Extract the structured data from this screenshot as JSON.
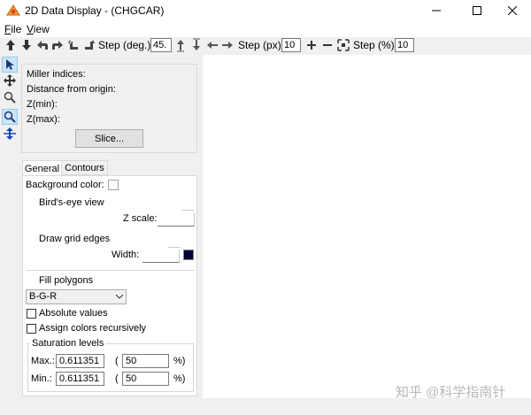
{
  "window": {
    "title": "2D Data Display - (CHGCAR)",
    "minimize_icon": "minimize-icon",
    "maximize_icon": "maximize-icon",
    "close_icon": "close-icon"
  },
  "menu": {
    "items": [
      "File",
      "View"
    ]
  },
  "toolbar": {
    "step_deg_label": "Step (deg.):",
    "step_deg_value": "45.",
    "step_px_label": "Step (px):",
    "step_px_value": "10",
    "step_pct_label": "Step (%):",
    "step_pct_value": "10"
  },
  "panel": {
    "miller_label": "Miller indices:",
    "distance_label": "Distance from origin:",
    "zmin_label": "Z(min):",
    "zmax_label": "Z(max):",
    "slice_button": "Slice..."
  },
  "tabs": [
    "General",
    "Contours"
  ],
  "general": {
    "background_color_label": "Background color:",
    "birds_eye_label": "Bird's-eye view",
    "z_scale_label": "Z scale:",
    "draw_grid_label": "Draw grid edges",
    "width_label": "Width:",
    "grid_color": "#000033",
    "fill_polygons_label": "Fill polygons",
    "fill_scheme_selected": "B-G-R",
    "absolute_values_label": "Absolute values",
    "assign_colors_label": "Assign colors recursively",
    "saturation": {
      "group_label": "Saturation levels",
      "max_label": "Max.:",
      "max_value": "0.611351",
      "max_pct": "50",
      "min_label": "Min.:",
      "min_value": "0.611351",
      "min_pct": "50",
      "open_paren": "(",
      "close_pct": "%)"
    }
  },
  "watermark": "知乎 @科学指南针"
}
